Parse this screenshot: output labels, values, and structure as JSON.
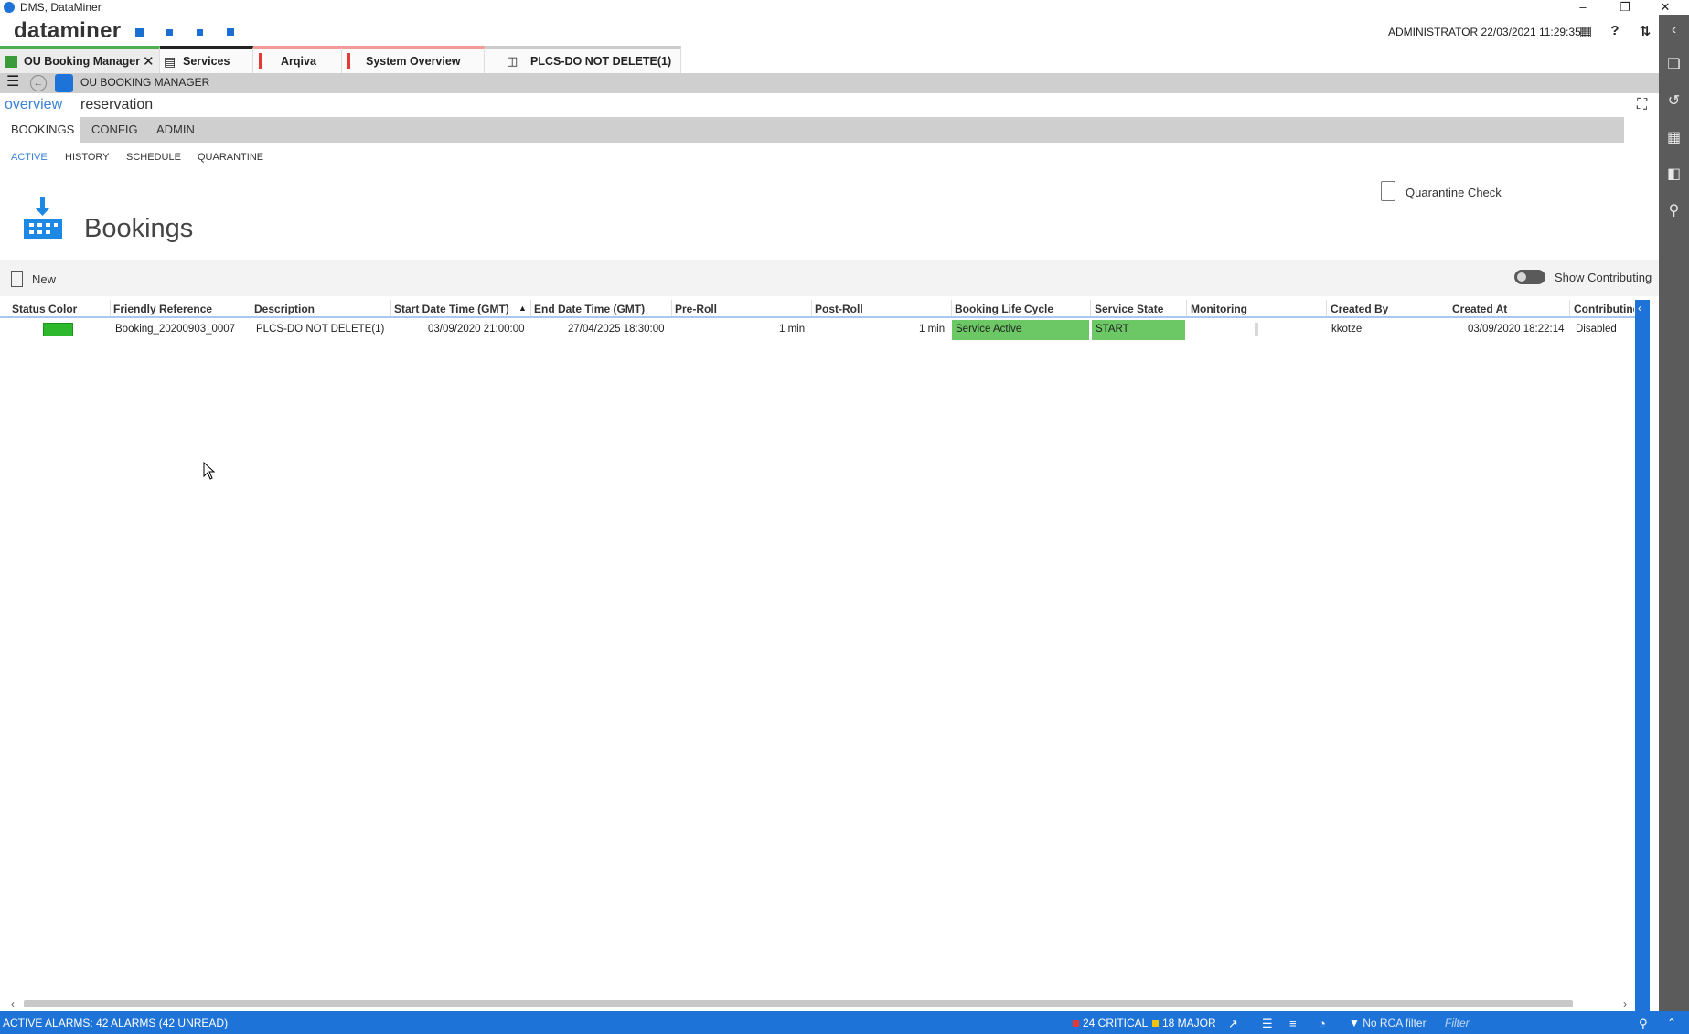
{
  "window": {
    "title": "DMS, DataMiner"
  },
  "header": {
    "logo": "dataminer",
    "user_info": "ADMINISTRATOR 22/03/2021 11:29:35"
  },
  "tabs": [
    {
      "label": "OU Booking Manager",
      "color": "#4caf50"
    },
    {
      "label": "Services",
      "color": "#222222"
    },
    {
      "label": "Arqiva",
      "color": "#e53935"
    },
    {
      "label": "System Overview",
      "color": "#e53935"
    },
    {
      "label": "PLCS-DO NOT DELETE(1)",
      "color": "#cccccc"
    }
  ],
  "subbar": {
    "label": "OU BOOKING MANAGER"
  },
  "breadcrumb": {
    "first": "overview",
    "second": "reservation"
  },
  "main_tabs": [
    "BOOKINGS",
    "CONFIG",
    "ADMIN"
  ],
  "sub_tabs": [
    "ACTIVE",
    "HISTORY",
    "SCHEDULE",
    "QUARANTINE"
  ],
  "page": {
    "title": "Bookings",
    "quarantine_check": "Quarantine Check",
    "new_label": "New",
    "show_contributing": "Show Contributing"
  },
  "table": {
    "headers": [
      "Status Color",
      "Friendly Reference",
      "Description",
      "Start Date Time (GMT)",
      "End Date Time (GMT)",
      "Pre-Roll",
      "Post-Roll",
      "Booking Life Cycle",
      "Service State",
      "Monitoring",
      "Created By",
      "Created At",
      "Contributing"
    ],
    "rows": [
      {
        "status_color": "#2eb82e",
        "friendly_reference": "Booking_20200903_0007",
        "description": "PLCS-DO NOT DELETE(1)",
        "start": "03/09/2020 21:00:00",
        "end": "27/04/2025 18:30:00",
        "pre_roll": "1 min",
        "post_roll": "1 min",
        "life_cycle": "Service Active",
        "service_state": "START",
        "monitoring": "",
        "created_by": "kkotze",
        "created_at": "03/09/2020 18:22:14",
        "contributing": "Disabled"
      }
    ]
  },
  "statusbar": {
    "alarms": "ACTIVE ALARMS: 42 ALARMS (42 UNREAD)",
    "critical": "24 CRITICAL",
    "major": "18 MAJOR",
    "rca": "No RCA filter",
    "filter_placeholder": "Filter",
    "critical_color": "#e53935",
    "major_color": "#f4c20d"
  }
}
